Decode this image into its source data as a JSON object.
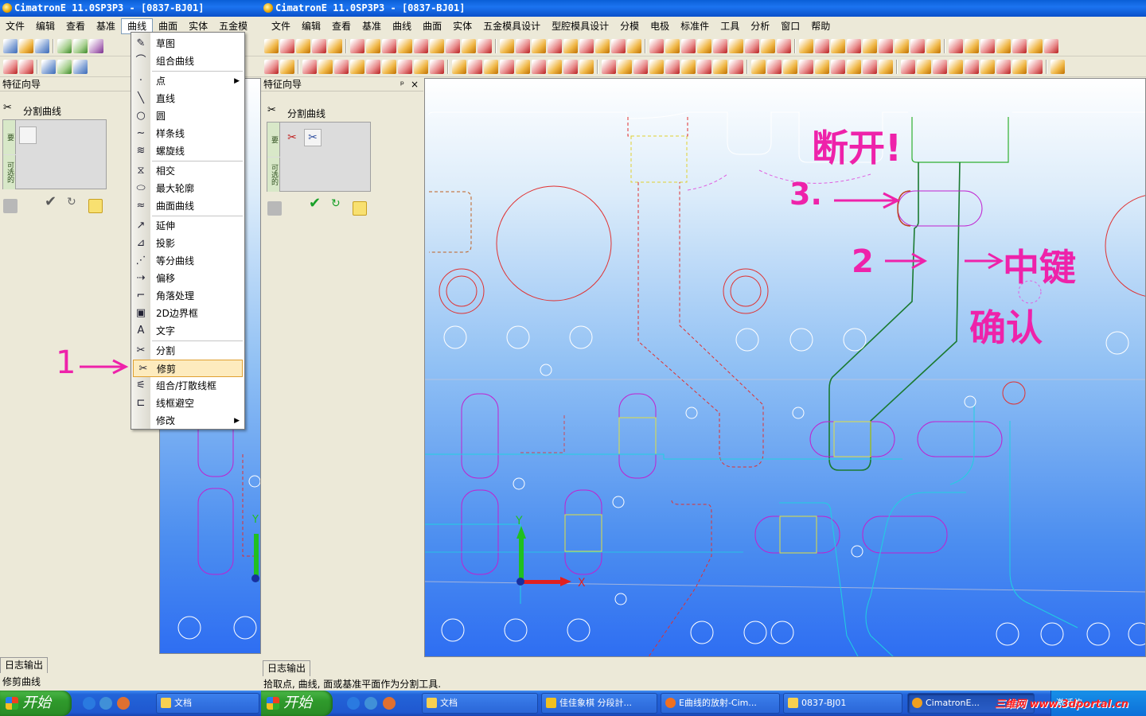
{
  "left_window": {
    "title": "CimatronE 11.0SP3P3 - [0837-BJ01]",
    "menu": [
      "文件",
      "编辑",
      "查看",
      "基准",
      "曲线",
      "曲面",
      "实体",
      "五金模"
    ],
    "active_menu": "曲线",
    "panel_title": "特征向导",
    "feature_label": "分割曲线",
    "tab_selected": "要",
    "tab_optional": "可选的",
    "bottom_tab": "日志输出",
    "status_text": "修剪曲线"
  },
  "right_window": {
    "title": "CimatronE 11.0SP3P3 - [0837-BJ01]",
    "menu": [
      "文件",
      "编辑",
      "查看",
      "基准",
      "曲线",
      "曲面",
      "实体",
      "五金模具设计",
      "型腔模具设计",
      "分模",
      "电极",
      "标准件",
      "工具",
      "分析",
      "窗口",
      "帮助"
    ],
    "panel_title": "特征向导",
    "panel_pin": "ᵖ",
    "panel_close": "×",
    "feature_label": "分割曲线",
    "tab_selected": "要",
    "tab_optional": "可选的",
    "bottom_tab": "日志输出",
    "status_text": "拾取点, 曲线, 面或基准平面作为分割工具.",
    "axis_y": "Y",
    "axis_x": "X"
  },
  "curve_menu": {
    "items": [
      {
        "label": "草图",
        "icon": "sketch-icon",
        "glyph": "✎"
      },
      {
        "label": "组合曲线",
        "icon": "composite-curve-icon",
        "glyph": "⌒"
      },
      {
        "label": "点",
        "icon": "point-icon",
        "glyph": "·",
        "submenu": true
      },
      {
        "label": "直线",
        "icon": "line-icon",
        "glyph": "╲"
      },
      {
        "label": "圆",
        "icon": "circle-icon",
        "glyph": "○"
      },
      {
        "label": "样条线",
        "icon": "spline-icon",
        "glyph": "∼"
      },
      {
        "label": "螺旋线",
        "icon": "helix-icon",
        "glyph": "≋"
      },
      {
        "label": "相交",
        "icon": "intersect-icon",
        "glyph": "⧖"
      },
      {
        "label": "最大轮廓",
        "icon": "max-profile-icon",
        "glyph": "⬭"
      },
      {
        "label": "曲面曲线",
        "icon": "surface-curve-icon",
        "glyph": "≈"
      },
      {
        "label": "延伸",
        "icon": "extend-icon",
        "glyph": "↗"
      },
      {
        "label": "投影",
        "icon": "project-icon",
        "glyph": "⊿"
      },
      {
        "label": "等分曲线",
        "icon": "divide-curve-icon",
        "glyph": "⋰"
      },
      {
        "label": "偏移",
        "icon": "offset-icon",
        "glyph": "⇢"
      },
      {
        "label": "角落处理",
        "icon": "corner-icon",
        "glyph": "⌐"
      },
      {
        "label": "2D边界框",
        "icon": "bounding-box-icon",
        "glyph": "▣"
      },
      {
        "label": "文字",
        "icon": "text-icon",
        "glyph": "A"
      },
      {
        "label": "分割",
        "icon": "split-icon",
        "glyph": "✂"
      },
      {
        "label": "修剪",
        "icon": "trim-icon",
        "glyph": "✂"
      },
      {
        "label": "组合/打散线框",
        "icon": "combine-wireframe-icon",
        "glyph": "⚟"
      },
      {
        "label": "线框避空",
        "icon": "wireframe-relief-icon",
        "glyph": "⊏"
      },
      {
        "label": "修改",
        "icon": "modify-icon",
        "glyph": "",
        "submenu": true
      }
    ],
    "highlighted": "修剪"
  },
  "annotations": {
    "step1": "1",
    "break_text": "断开!",
    "step3": "3.",
    "step2": "2",
    "middle_key": "中键",
    "confirm": "确认"
  },
  "taskbar": {
    "start": "开始",
    "left_tasks": [
      "文档"
    ],
    "right_tasks": [
      "文档",
      "佳佳象棋 分段計...",
      "E曲线的放射-Cim...",
      "0837-BJ01",
      "CimatronE..."
    ],
    "tray_text": "激活的"
  },
  "watermark": "三维网 www.3dportal.cn",
  "colors": {
    "title_blue": "#0a5fd7",
    "menu_highlight": "#fdebbe",
    "annotation_pink": "#ee22aa",
    "curve_green": "#1a7a30",
    "curve_red": "#d02020",
    "curve_magenta": "#c020d0",
    "curve_cyan": "#20d0e0"
  }
}
